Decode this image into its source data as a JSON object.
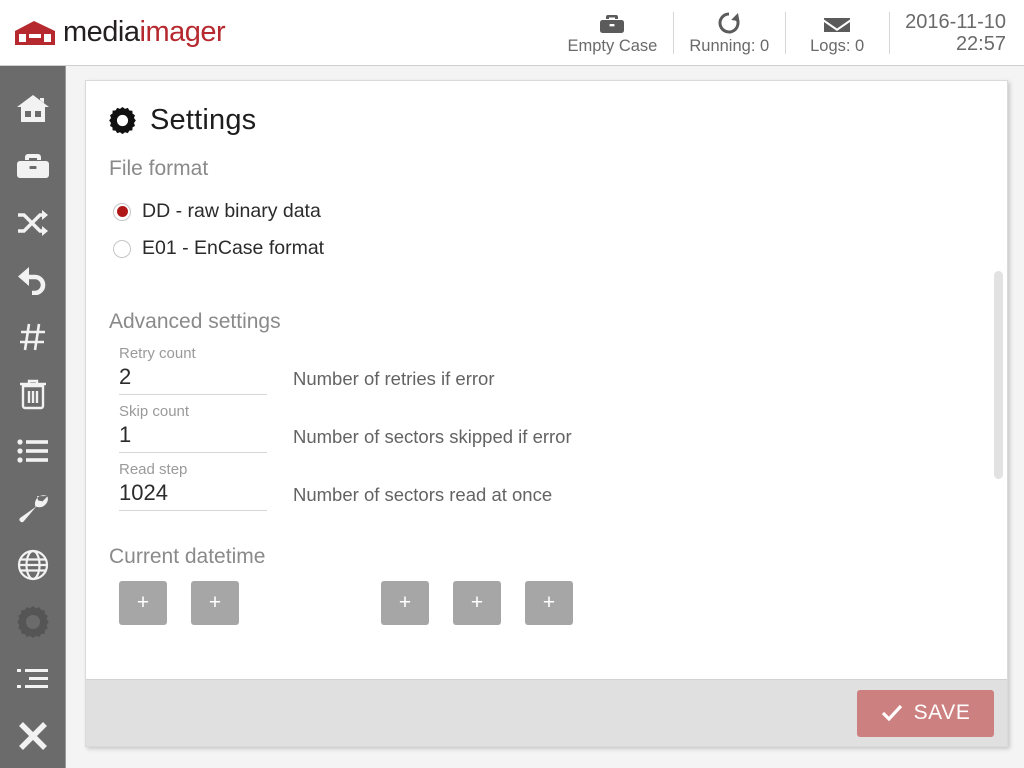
{
  "app": {
    "logo_primary": "media",
    "logo_accent": "imager",
    "brand_red": "#b5292f",
    "accent_red": "#b01818",
    "save_button_color": "#cd8080",
    "sidebar_color": "#6b6b6b"
  },
  "header": {
    "items": [
      {
        "icon": "briefcase-icon",
        "label": "Empty Case"
      },
      {
        "icon": "refresh-icon",
        "label": "Running: 0"
      },
      {
        "icon": "envelope-icon",
        "label": "Logs: 0"
      }
    ],
    "datetime": {
      "date": "2016-11-10",
      "time": "22:57"
    }
  },
  "sidebar": {
    "items": [
      {
        "icon": "home-icon",
        "name": "home",
        "active": false
      },
      {
        "icon": "briefcase-icon",
        "name": "case",
        "active": false
      },
      {
        "icon": "shuffle-icon",
        "name": "shuffle",
        "active": false
      },
      {
        "icon": "undo-icon",
        "name": "undo",
        "active": false
      },
      {
        "icon": "hash-icon",
        "name": "hash",
        "active": false
      },
      {
        "icon": "trash-icon",
        "name": "wipe",
        "active": false
      },
      {
        "icon": "list-icon",
        "name": "list",
        "active": false
      },
      {
        "icon": "wrench-icon",
        "name": "tools",
        "active": false
      },
      {
        "icon": "globe-icon",
        "name": "network",
        "active": false
      },
      {
        "icon": "gear-icon",
        "name": "settings",
        "active": true
      },
      {
        "icon": "indent-list-icon",
        "name": "logs",
        "active": false
      },
      {
        "icon": "close-icon",
        "name": "exit",
        "active": false
      }
    ]
  },
  "main": {
    "title": "Settings",
    "title_icon": "gear-icon",
    "file_format": {
      "label": "File format",
      "options": [
        {
          "label": "DD - raw binary data",
          "selected": true
        },
        {
          "label": "E01 - EnCase format",
          "selected": false
        }
      ]
    },
    "advanced": {
      "label": "Advanced settings",
      "fields": [
        {
          "label": "Retry count",
          "value": "2",
          "description": "Number of retries if error"
        },
        {
          "label": "Skip count",
          "value": "1",
          "description": "Number of sectors skipped if error"
        },
        {
          "label": "Read step",
          "value": "1024",
          "description": "Number of sectors read at once"
        }
      ]
    },
    "datetime": {
      "label": "Current datetime",
      "steppers": [
        {
          "label": "+",
          "name": "year-increment"
        },
        {
          "label": "+",
          "name": "month-increment"
        },
        {
          "label": "+",
          "name": "hour-increment"
        },
        {
          "label": "+",
          "name": "minute-increment"
        },
        {
          "label": "+",
          "name": "second-increment"
        }
      ]
    }
  },
  "footer": {
    "save_label": "SAVE",
    "save_icon": "check-icon"
  }
}
